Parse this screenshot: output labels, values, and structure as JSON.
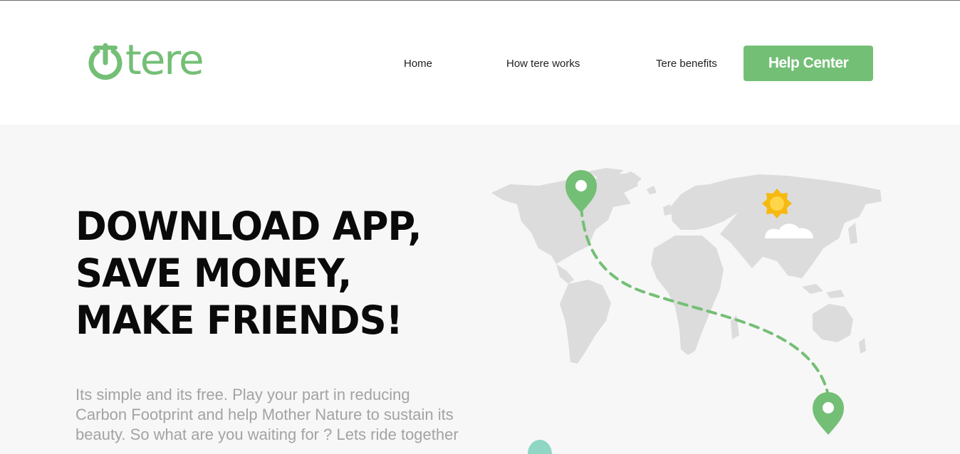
{
  "brand": {
    "name": "tere",
    "color": "#74bf76"
  },
  "nav": {
    "home": "Home",
    "how": "How tere works",
    "benefits": "Tere benefits",
    "help": "Help Center"
  },
  "hero": {
    "headline": "DOWNLOAD APP, SAVE MONEY, MAKE FRIENDS!",
    "subtext": "Its simple and its free. Play your part in reducing Carbon Footprint and help Mother Nature to sustain its beauty. So what are you waiting for ? Lets ride together"
  },
  "colors": {
    "accent": "#74bf76",
    "hero_bg": "#f7f7f7",
    "map_land": "#dcdcdc",
    "sun": "#f6b90f"
  },
  "icons": [
    "power-logo-icon",
    "map-pin-icon",
    "sun-icon",
    "cloud-icon"
  ]
}
